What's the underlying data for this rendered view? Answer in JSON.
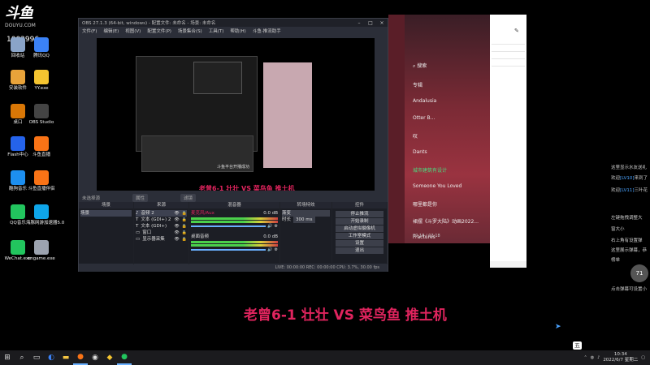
{
  "watermark": {
    "logo": "斗鱼",
    "sub": "DOUYU.COM",
    "room_id": "1002996"
  },
  "desktop_icons": [
    {
      "label": "回收站",
      "color": "#8aa4c8"
    },
    {
      "label": "腾讯QQ",
      "color": "#3b82f6"
    },
    {
      "label": "安装软件",
      "color": "#e8a33a"
    },
    {
      "label": "YY.exe",
      "color": "#f4c430"
    },
    {
      "label": "桌口",
      "color": "#d97706"
    },
    {
      "label": "OBS Studio",
      "color": "#444444"
    },
    {
      "label": "Flash中心",
      "color": "#2563eb"
    },
    {
      "label": "斗鱼直播",
      "color": "#f97316"
    },
    {
      "label": "酷狗音乐",
      "color": "#1d8ff0"
    },
    {
      "label": "斗鱼直播伴侣",
      "color": "#f97316"
    },
    {
      "label": "QQ音乐",
      "color": "#22c55e"
    },
    {
      "label": "海豚网游加速器5.0",
      "color": "#0ea5e9"
    },
    {
      "label": "WeChat.exe",
      "color": "#22c55e"
    },
    {
      "label": "cngame.exe",
      "color": "#9ca3af"
    }
  ],
  "obs": {
    "title": "OBS 27.1.3 (64-bit, windows) - 配置文件: 未命名 - 场景: 未命名",
    "menu": [
      "文件(F)",
      "编辑(E)",
      "视图(V)",
      "配置文件(P)",
      "场景集合(S)",
      "工具(T)",
      "帮助(H)",
      "斗鱼-推流助手"
    ],
    "preview_caption": "老曾6-1 壮壮 VS 菜鸟鱼 推土机",
    "nested_text": "斗鱼平台开播成功",
    "no_source": "未选择源",
    "props_button": "属性",
    "filter_button": "滤镜",
    "docks": {
      "scenes": {
        "title": "场景",
        "items": [
          "场景"
        ]
      },
      "sources": {
        "title": "来源",
        "items": [
          "音频 2",
          "文本 (GDI+) 2",
          "文本 (GDI+)",
          "窗口",
          "显示器采集"
        ]
      },
      "mixer": {
        "title": "混音器",
        "channels": [
          {
            "name": "麦克风/Aux",
            "db": "0.0 dB"
          },
          {
            "name": "桌面音频",
            "db": "0.0 dB"
          }
        ]
      },
      "transitions": {
        "title": "转场特效",
        "type": "渐变",
        "duration_label": "时长",
        "duration": "300 ms"
      },
      "controls": {
        "title": "控件",
        "buttons": [
          "停止推流",
          "开始录制",
          "启动虚拟摄像机",
          "工作室模式",
          "设置",
          "退出"
        ]
      }
    },
    "status": "LIVE: 00:00:00   REC: 00:00:00   CPU: 3.7%, 30.00 fps"
  },
  "music": {
    "search": "搜索",
    "songs": [
      {
        "title": "专辑",
        "highlight": false
      },
      {
        "title": "Andalusia",
        "highlight": false
      },
      {
        "title": "Otter B...",
        "highlight": false
      },
      {
        "title": "叹",
        "highlight": false
      },
      {
        "title": "Dants",
        "highlight": false
      },
      {
        "title": "城市建筑有设计",
        "highlight": true
      },
      {
        "title": "Someone You Loved",
        "highlight": false
      },
      {
        "title": "哪里都是你",
        "highlight": false
      },
      {
        "title": "裙摆《斗罗大陆》动画2022...",
        "highlight": false
      },
      {
        "title": "Fractures",
        "highlight": false
      }
    ],
    "now_playing": "00:18 / 03:18"
  },
  "danmaku": [
    {
      "text": "这里显示水友送礼",
      "hl": ""
    },
    {
      "text": "欢迎",
      "hl": "[LV10]",
      "tail": "来到了"
    },
    {
      "text": "欢迎",
      "hl": "[LV11]",
      "tail": "三叶花"
    },
    {
      "text": "左键拖拽调整大",
      "hl": ""
    },
    {
      "text": "窗大小",
      "hl": ""
    },
    {
      "text": "右上角有设置弹",
      "hl": ""
    },
    {
      "text": "这里展示弹幕，恭",
      "hl": ""
    },
    {
      "text": "榜单",
      "hl": ""
    },
    {
      "text": "点击弹幕可设置小",
      "hl": ""
    }
  ],
  "side_badge": "71",
  "big_title": "老曾6-1 壮壮 VS 菜鸟鱼 推土机",
  "taskbar": {
    "time": "10:34",
    "date": "2022/6/7 星期二",
    "ime": "五"
  }
}
